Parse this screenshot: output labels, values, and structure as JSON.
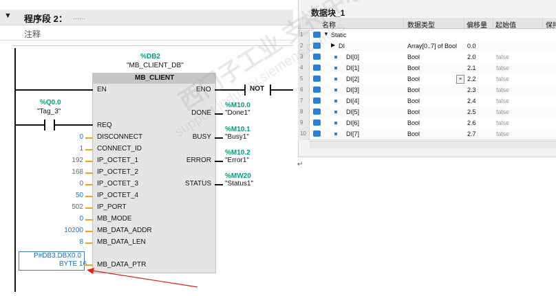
{
  "network": {
    "title": "程序段 2：",
    "title_placeholder": "......",
    "comment_label": "注释"
  },
  "block": {
    "instance_db_address": "%DB2",
    "instance_db_name": "\"MB_CLIENT_DB\"",
    "type_name": "MB_CLIENT",
    "pins": {
      "en": "EN",
      "eno": "ENO"
    },
    "not_contact": "NOT",
    "req_tag": {
      "address": "%Q0.0",
      "name": "\"Tag_3\""
    },
    "inputs": [
      {
        "pin": "REQ",
        "value": "",
        "color": "black"
      },
      {
        "pin": "DISCONNECT",
        "value": "0",
        "color": "blue"
      },
      {
        "pin": "CONNECT_ID",
        "value": "1",
        "color": "gray"
      },
      {
        "pin": "IP_OCTET_1",
        "value": "192",
        "color": "gray"
      },
      {
        "pin": "IP_OCTET_2",
        "value": "168",
        "color": "gray"
      },
      {
        "pin": "IP_OCTET_3",
        "value": "0",
        "color": "gray"
      },
      {
        "pin": "IP_OCTET_4",
        "value": "50",
        "color": "blue"
      },
      {
        "pin": "IP_PORT",
        "value": "502",
        "color": "gray"
      },
      {
        "pin": "MB_MODE",
        "value": "0",
        "color": "blue"
      },
      {
        "pin": "MB_DATA_ADDR",
        "value": "10200",
        "color": "blue"
      },
      {
        "pin": "MB_DATA_LEN",
        "value": "8",
        "color": "blue"
      }
    ],
    "outputs": [
      {
        "pin": "DONE",
        "address": "%M10.0",
        "name": "\"Done1\""
      },
      {
        "pin": "BUSY",
        "address": "%M10.1",
        "name": "\"Busy1\""
      },
      {
        "pin": "ERROR",
        "address": "%M10.2",
        "name": "\"Error1\""
      },
      {
        "pin": "STATUS",
        "address": "%MW20",
        "name": "\"Status1\""
      }
    ],
    "data_ptr": {
      "pin": "MB_DATA_PTR",
      "line1": "P#DB3.DBX0.0",
      "line2": "BYTE 16"
    }
  },
  "datablock": {
    "title": "数据块_1",
    "columns": [
      "名称",
      "数据类型",
      "偏移量",
      "起始值",
      "保持"
    ],
    "rows": [
      {
        "num": "1",
        "name": "Static",
        "type": "",
        "offset": "",
        "start": "",
        "level": 0,
        "expander": "▼"
      },
      {
        "num": "2",
        "name": "DI",
        "type": "Array[0..7] of Bool",
        "offset": "0.0",
        "start": "",
        "level": 1,
        "expander": "▶"
      },
      {
        "num": "3",
        "name": "DI[0]",
        "type": "Bool",
        "offset": "2.0",
        "start": "false",
        "level": 2,
        "expander": ""
      },
      {
        "num": "4",
        "name": "DI[1]",
        "type": "Bool",
        "offset": "2.1",
        "start": "false",
        "level": 2,
        "expander": ""
      },
      {
        "num": "5",
        "name": "DI[2]",
        "type": "Bool",
        "offset": "2.2",
        "start": "false",
        "level": 2,
        "expander": ""
      },
      {
        "num": "6",
        "name": "DI[3]",
        "type": "Bool",
        "offset": "2.3",
        "start": "false",
        "level": 2,
        "expander": ""
      },
      {
        "num": "7",
        "name": "DI[4]",
        "type": "Bool",
        "offset": "2.4",
        "start": "false",
        "level": 2,
        "expander": ""
      },
      {
        "num": "8",
        "name": "DI[5]",
        "type": "Bool",
        "offset": "2.5",
        "start": "false",
        "level": 2,
        "expander": ""
      },
      {
        "num": "9",
        "name": "DI[6]",
        "type": "Bool",
        "offset": "2.6",
        "start": "false",
        "level": 2,
        "expander": ""
      },
      {
        "num": "10",
        "name": "DI[7]",
        "type": "Bool",
        "offset": "2.7",
        "start": "false",
        "level": 2,
        "expander": ""
      }
    ],
    "paragraph_mark": "↵"
  },
  "watermark": {
    "line1": "西门子工业 支持中心",
    "line2": "support.industry.siemens.com/cs"
  },
  "colors": {
    "address_green": "#00a079",
    "value_blue": "#1f6fc5",
    "wire_orange": "#f5a020",
    "annotation_red": "#e0261c",
    "icon_blue": "#2f7fd0"
  }
}
